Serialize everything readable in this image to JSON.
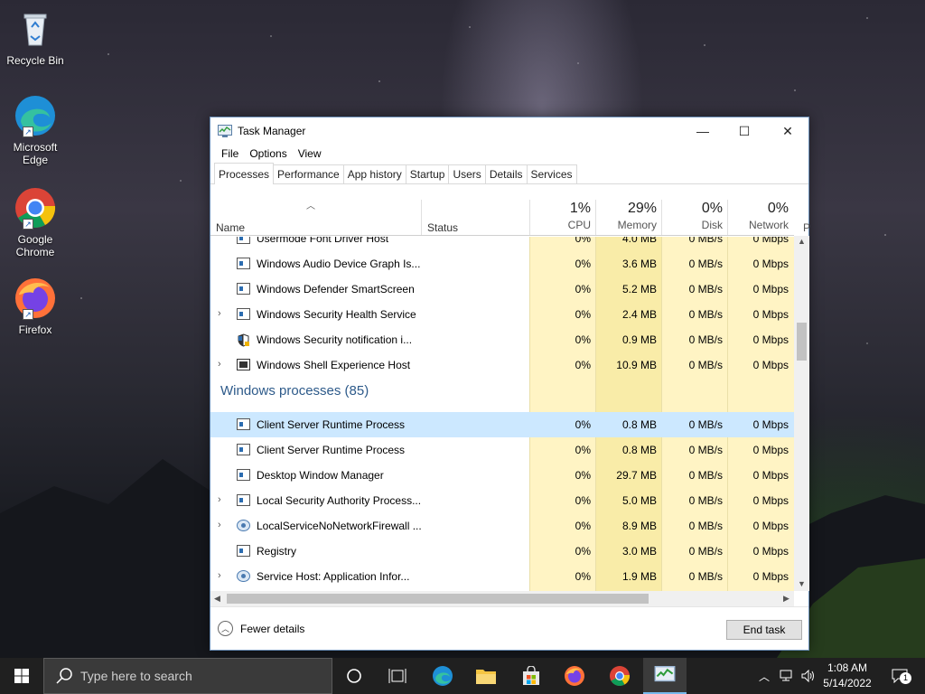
{
  "desktop": {
    "icons": [
      {
        "label_lines": [
          "Recycle Bin"
        ]
      },
      {
        "label_lines": [
          "Microsoft",
          "Edge"
        ]
      },
      {
        "label_lines": [
          "Google",
          "Chrome"
        ]
      },
      {
        "label_lines": [
          "Firefox"
        ]
      }
    ]
  },
  "window": {
    "title": "Task Manager",
    "controls": {
      "minimize": "—",
      "maximize": "☐",
      "close": "✕"
    },
    "menu": [
      "File",
      "Options",
      "View"
    ],
    "tabs": [
      "Processes",
      "Performance",
      "App history",
      "Startup",
      "Users",
      "Details",
      "Services"
    ],
    "active_tab": "Processes",
    "columns": {
      "name": "Name",
      "status": "Status",
      "cpu": {
        "pct": "1%",
        "label": "CPU"
      },
      "memory": {
        "pct": "29%",
        "label": "Memory"
      },
      "disk": {
        "pct": "0%",
        "label": "Disk"
      },
      "network": {
        "pct": "0%",
        "label": "Network"
      },
      "power": "P"
    },
    "rows_top": [
      {
        "name": "Usermode Font Driver Host",
        "cpu": "0%",
        "memory": "4.0 MB",
        "disk": "0 MB/s",
        "network": "0 Mbps",
        "icon": "window",
        "expandable": false
      },
      {
        "name": "Windows Audio Device Graph Is...",
        "cpu": "0%",
        "memory": "3.6 MB",
        "disk": "0 MB/s",
        "network": "0 Mbps",
        "icon": "window",
        "expandable": false
      },
      {
        "name": "Windows Defender SmartScreen",
        "cpu": "0%",
        "memory": "5.2 MB",
        "disk": "0 MB/s",
        "network": "0 Mbps",
        "icon": "window",
        "expandable": false
      },
      {
        "name": "Windows Security Health Service",
        "cpu": "0%",
        "memory": "2.4 MB",
        "disk": "0 MB/s",
        "network": "0 Mbps",
        "icon": "window",
        "expandable": true
      },
      {
        "name": "Windows Security notification i...",
        "cpu": "0%",
        "memory": "0.9 MB",
        "disk": "0 MB/s",
        "network": "0 Mbps",
        "icon": "shield",
        "expandable": false
      },
      {
        "name": "Windows Shell Experience Host",
        "cpu": "0%",
        "memory": "10.9 MB",
        "disk": "0 MB/s",
        "network": "0 Mbps",
        "icon": "monitor",
        "expandable": true
      }
    ],
    "group_title": "Windows processes (85)",
    "rows_group": [
      {
        "name": "Client Server Runtime Process",
        "cpu": "0%",
        "memory": "0.8 MB",
        "disk": "0 MB/s",
        "network": "0 Mbps",
        "icon": "window",
        "expandable": false,
        "selected": true
      },
      {
        "name": "Client Server Runtime Process",
        "cpu": "0%",
        "memory": "0.8 MB",
        "disk": "0 MB/s",
        "network": "0 Mbps",
        "icon": "window",
        "expandable": false
      },
      {
        "name": "Desktop Window Manager",
        "cpu": "0%",
        "memory": "29.7 MB",
        "disk": "0 MB/s",
        "network": "0 Mbps",
        "icon": "window",
        "expandable": false
      },
      {
        "name": "Local Security Authority Process...",
        "cpu": "0%",
        "memory": "5.0 MB",
        "disk": "0 MB/s",
        "network": "0 Mbps",
        "icon": "window",
        "expandable": true
      },
      {
        "name": "LocalServiceNoNetworkFirewall ...",
        "cpu": "0%",
        "memory": "8.9 MB",
        "disk": "0 MB/s",
        "network": "0 Mbps",
        "icon": "gear",
        "expandable": true
      },
      {
        "name": "Registry",
        "cpu": "0%",
        "memory": "3.0 MB",
        "disk": "0 MB/s",
        "network": "0 Mbps",
        "icon": "window",
        "expandable": false
      },
      {
        "name": "Service Host: Application Infor...",
        "cpu": "0%",
        "memory": "1.9 MB",
        "disk": "0 MB/s",
        "network": "0 Mbps",
        "icon": "gear",
        "expandable": true
      }
    ],
    "footer": {
      "fewer_details": "Fewer details",
      "end_task": "End task"
    }
  },
  "taskbar": {
    "search_placeholder": "Type here to search",
    "clock_time": "1:08 AM",
    "clock_date": "5/14/2022",
    "notification_count": "1"
  },
  "colors": {
    "heat_light": "#fff4c4",
    "heat_memory": "#f9eca8",
    "selected_row": "#cce8ff",
    "group_title": "#2d5a8a",
    "taskbar": "#202020"
  }
}
